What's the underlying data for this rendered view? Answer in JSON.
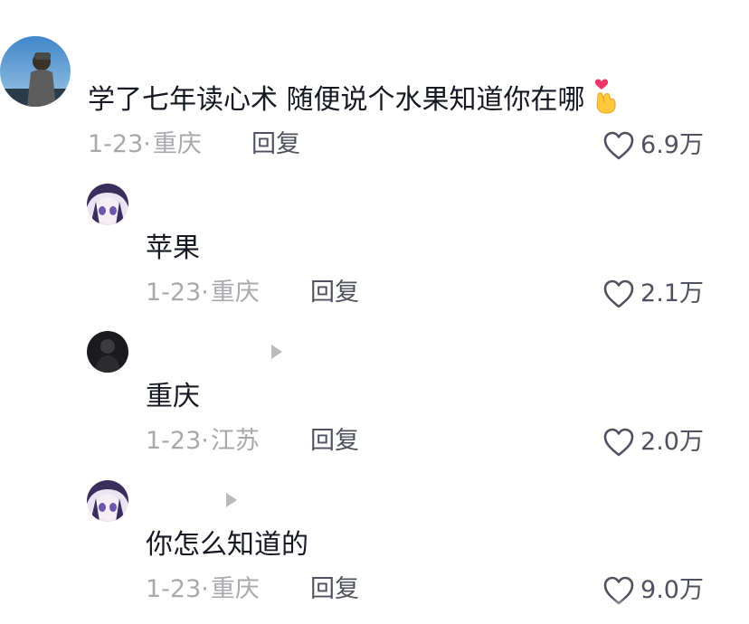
{
  "comments": [
    {
      "text": "学了七年读心术 随便说个水果知道你在哪",
      "emoji_icon": "finger-heart-icon",
      "date": "1-23·",
      "location": "重庆",
      "reply_label": "回复",
      "like_count": "6.9万"
    },
    {
      "text": "苹果",
      "date": "1-23·",
      "location": "重庆",
      "reply_label": "回复",
      "like_count": "2.1万"
    },
    {
      "text": "重庆",
      "date": "1-23·",
      "location": "江苏",
      "reply_label": "回复",
      "like_count": "2.0万"
    },
    {
      "text": "你怎么知道的",
      "date": "1-23·",
      "location": "重庆",
      "reply_label": "回复",
      "like_count": "9.0万"
    }
  ],
  "colors": {
    "text": "#161823",
    "meta": "#a8a9ae",
    "reply": "#4f5160"
  }
}
